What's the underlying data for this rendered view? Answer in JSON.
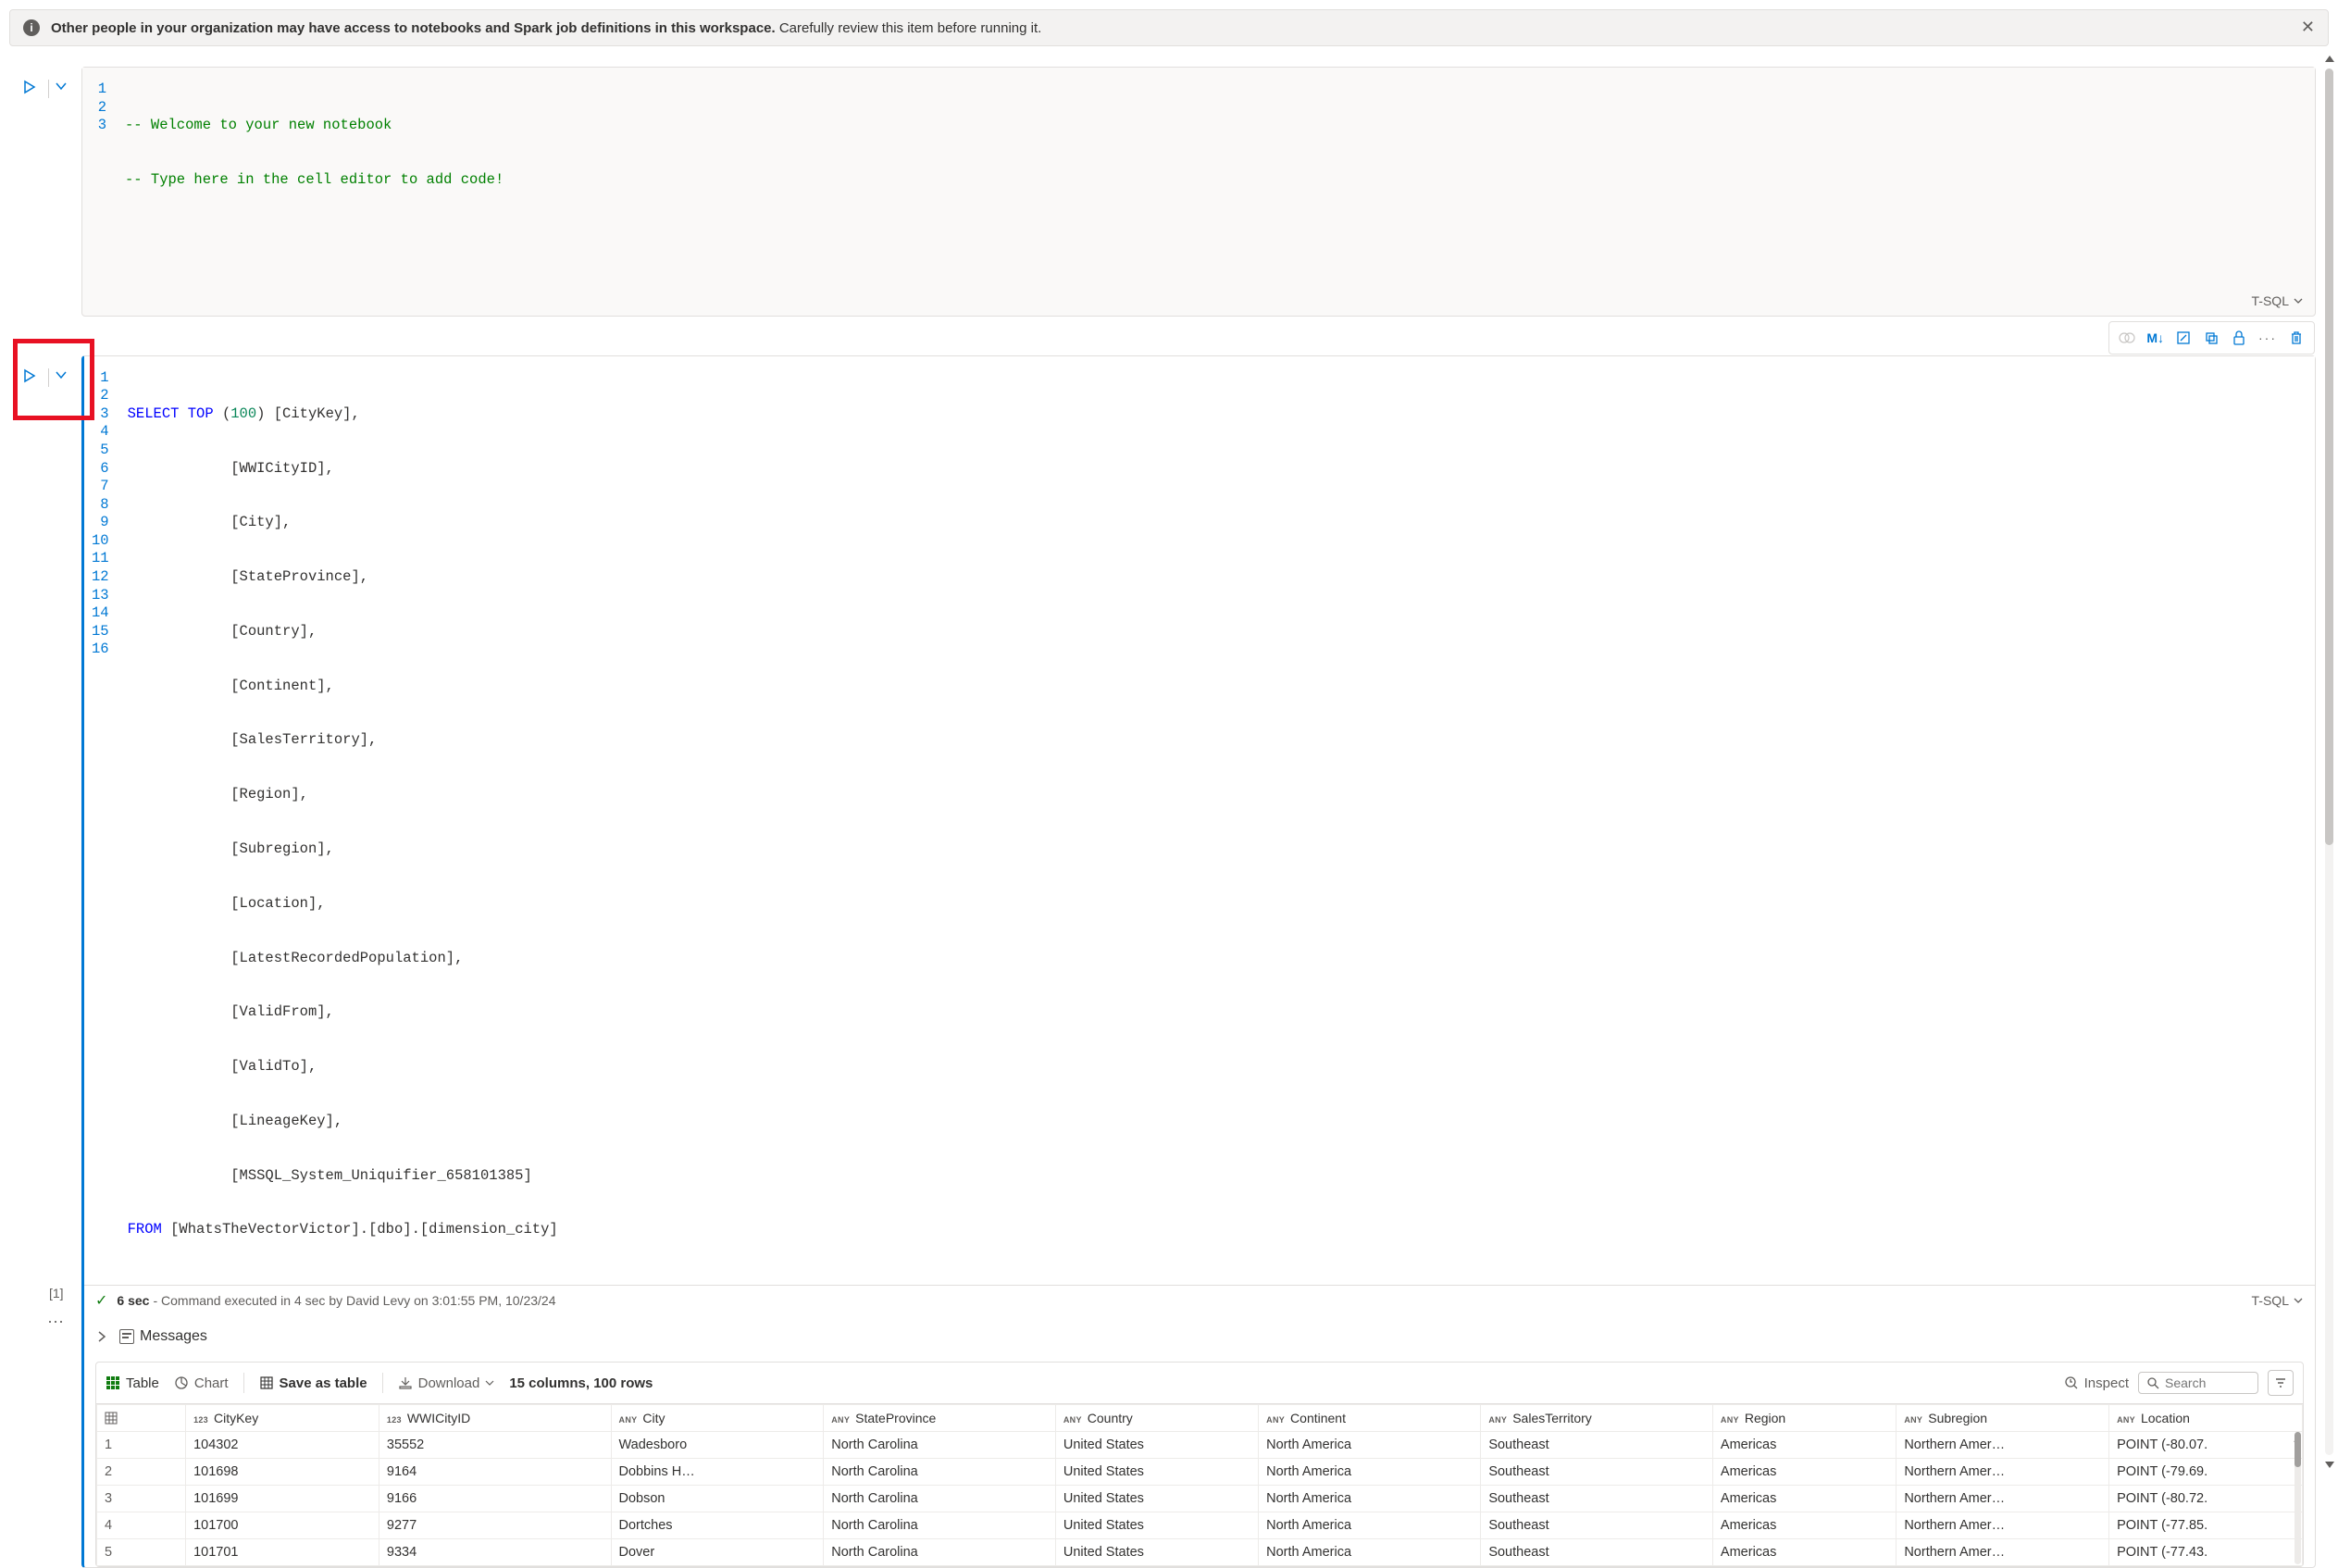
{
  "notification": {
    "bold": "Other people in your organization may have access to notebooks and Spark job definitions in this workspace.",
    "rest": " Carefully review this item before running it."
  },
  "cell1": {
    "language": "T-SQL",
    "code_lines": [
      "-- Welcome to your new notebook",
      "-- Type here in the cell editor to add code!",
      ""
    ]
  },
  "cell2": {
    "language": "T-SQL",
    "exec_index": "[1]",
    "status": {
      "duration": "6 sec",
      "text": "- Command executed in 4 sec by David Levy on 3:01:55 PM, 10/23/24"
    },
    "code": {
      "l1_a": "SELECT",
      "l1_b": " TOP ",
      "l1_c": "(",
      "l1_d": "100",
      "l1_e": ") [CityKey],",
      "l2": "            [WWICityID],",
      "l3": "            [City],",
      "l4": "            [StateProvince],",
      "l5": "            [Country],",
      "l6": "            [Continent],",
      "l7": "            [SalesTerritory],",
      "l8": "            [Region],",
      "l9": "            [Subregion],",
      "l10": "            [Location],",
      "l11": "            [LatestRecordedPopulation],",
      "l12": "            [ValidFrom],",
      "l13": "            [ValidTo],",
      "l14": "            [LineageKey],",
      "l15": "            [MSSQL_System_Uniquifier_658101385]",
      "l16_a": "FROM",
      "l16_b": " [WhatsTheVectorVictor].[dbo].[dimension_city]"
    }
  },
  "toolbar_markdown": "M↓",
  "messages_label": "Messages",
  "results": {
    "tabs": {
      "table": "Table",
      "chart": "Chart"
    },
    "save_as_table": "Save as table",
    "download": "Download",
    "summary": "15 columns, 100 rows",
    "inspect": "Inspect",
    "search_placeholder": "Search",
    "columns": [
      {
        "type": "123",
        "name": "CityKey"
      },
      {
        "type": "123",
        "name": "WWICityID"
      },
      {
        "type": "ANY",
        "name": "City"
      },
      {
        "type": "ANY",
        "name": "StateProvince"
      },
      {
        "type": "ANY",
        "name": "Country"
      },
      {
        "type": "ANY",
        "name": "Continent"
      },
      {
        "type": "ANY",
        "name": "SalesTerritory"
      },
      {
        "type": "ANY",
        "name": "Region"
      },
      {
        "type": "ANY",
        "name": "Subregion"
      },
      {
        "type": "ANY",
        "name": "Location"
      }
    ],
    "rows": [
      {
        "n": "1",
        "CityKey": "104302",
        "WWICityID": "35552",
        "City": "Wadesboro",
        "StateProvince": "North Carolina",
        "Country": "United States",
        "Continent": "North America",
        "SalesTerritory": "Southeast",
        "Region": "Americas",
        "Subregion": "Northern Amer…",
        "Location": "POINT (-80.07."
      },
      {
        "n": "2",
        "CityKey": "101698",
        "WWICityID": "9164",
        "City": "Dobbins H…",
        "StateProvince": "North Carolina",
        "Country": "United States",
        "Continent": "North America",
        "SalesTerritory": "Southeast",
        "Region": "Americas",
        "Subregion": "Northern Amer…",
        "Location": "POINT (-79.69."
      },
      {
        "n": "3",
        "CityKey": "101699",
        "WWICityID": "9166",
        "City": "Dobson",
        "StateProvince": "North Carolina",
        "Country": "United States",
        "Continent": "North America",
        "SalesTerritory": "Southeast",
        "Region": "Americas",
        "Subregion": "Northern Amer…",
        "Location": "POINT (-80.72."
      },
      {
        "n": "4",
        "CityKey": "101700",
        "WWICityID": "9277",
        "City": "Dortches",
        "StateProvince": "North Carolina",
        "Country": "United States",
        "Continent": "North America",
        "SalesTerritory": "Southeast",
        "Region": "Americas",
        "Subregion": "Northern Amer…",
        "Location": "POINT (-77.85."
      },
      {
        "n": "5",
        "CityKey": "101701",
        "WWICityID": "9334",
        "City": "Dover",
        "StateProvince": "North Carolina",
        "Country": "United States",
        "Continent": "North America",
        "SalesTerritory": "Southeast",
        "Region": "Americas",
        "Subregion": "Northern Amer…",
        "Location": "POINT (-77.43."
      }
    ]
  }
}
